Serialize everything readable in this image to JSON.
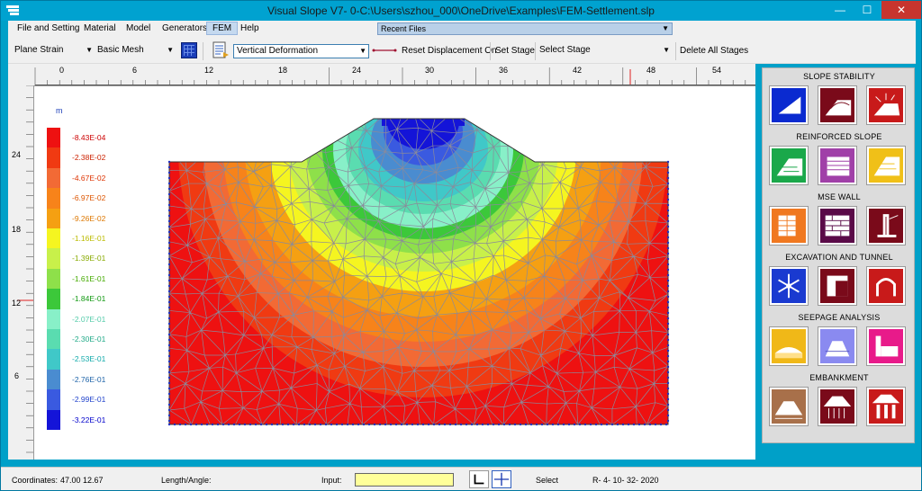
{
  "window": {
    "title": "Visual Slope V7- 0-C:\\Users\\szhou_000\\OneDrive\\Examples\\FEM-Settlement.slp",
    "minimize": "—",
    "maximize": "☐",
    "close": "✕"
  },
  "menu": {
    "items": [
      "File and Setting",
      "Material",
      "Model",
      "Generators",
      "FEM",
      "Help"
    ],
    "active": "FEM",
    "recent_files": "Recent Files"
  },
  "toolbar": {
    "analysis_type": "Plane Strain",
    "mesh_type": "Basic Mesh",
    "result_type": "Vertical Deformation",
    "reset_displacement": "Reset Displacement On",
    "set_stage": "Set Stage",
    "select_stage": "Select Stage",
    "delete_all_stages": "Delete All Stages"
  },
  "ruler": {
    "top_ticks": [
      "0",
      "6",
      "12",
      "18",
      "24",
      "30",
      "36",
      "42",
      "48",
      "54"
    ],
    "left_ticks": [
      "24",
      "18",
      "12",
      "6"
    ]
  },
  "legend": {
    "unit": "m",
    "entries": [
      {
        "label": "-8.43E-04",
        "color": "#ee1111",
        "text_color": "#cc0000"
      },
      {
        "label": "-2.38E-02",
        "color": "#f03a12",
        "text_color": "#cc2200"
      },
      {
        "label": "-4.67E-02",
        "color": "#f26a35",
        "text_color": "#dd3300"
      },
      {
        "label": "-6.97E-02",
        "color": "#f7831a",
        "text_color": "#dd5500"
      },
      {
        "label": "-9.26E-02",
        "color": "#f5a012",
        "text_color": "#dd7700"
      },
      {
        "label": "-1.16E-01",
        "color": "#f5f520",
        "text_color": "#bbbb00"
      },
      {
        "label": "-1.39E-01",
        "color": "#c8f04a",
        "text_color": "#88aa00"
      },
      {
        "label": "-1.61E-01",
        "color": "#8ee04a",
        "text_color": "#44aa00"
      },
      {
        "label": "-1.84E-01",
        "color": "#3cc83a",
        "text_color": "#119911"
      },
      {
        "label": "-2.07E-01",
        "color": "#88f0c8",
        "text_color": "#55ccaa"
      },
      {
        "label": "-2.30E-01",
        "color": "#5adcb0",
        "text_color": "#22aa88"
      },
      {
        "label": "-2.53E-01",
        "color": "#40c8c8",
        "text_color": "#11aaaa"
      },
      {
        "label": "-2.76E-01",
        "color": "#4a8cd0",
        "text_color": "#2266aa"
      },
      {
        "label": "-2.99E-01",
        "color": "#3a5ae0",
        "text_color": "#2244cc"
      },
      {
        "label": "-3.22E-01",
        "color": "#1414d8",
        "text_color": "#0000cc"
      }
    ]
  },
  "right_panel": {
    "sections": [
      {
        "title": "SLOPE STABILITY",
        "buttons": [
          "slope-limit-equilibrium-icon",
          "slope-3d-icon",
          "slope-seismic-icon"
        ],
        "colors": [
          "#0a2ad0",
          "#7a0a1a",
          "#c81a1a"
        ]
      },
      {
        "title": "REINFORCED SLOPE",
        "buttons": [
          "geogrid-slope-icon",
          "soil-nail-slope-icon",
          "reinforced-layers-icon"
        ],
        "colors": [
          "#1aa84a",
          "#a040a8",
          "#f0c018"
        ]
      },
      {
        "title": "MSE WALL",
        "buttons": [
          "mse-block-wall-icon",
          "mse-panel-wall-icon",
          "cantilever-wall-icon"
        ],
        "colors": [
          "#f07820",
          "#5a0a48",
          "#7a0a1a"
        ]
      },
      {
        "title": "EXCAVATION AND TUNNEL",
        "buttons": [
          "frozen-ground-icon",
          "excavation-wall-icon",
          "tunnel-icon"
        ],
        "colors": [
          "#1a3ad0",
          "#7a0a1a",
          "#c81a1a"
        ]
      },
      {
        "title": "SEEPAGE ANALYSIS",
        "buttons": [
          "seepage-dam-icon",
          "seepage-embankment-icon",
          "seepage-wall-icon"
        ],
        "colors": [
          "#f0b818",
          "#8a8af0",
          "#e81a8a"
        ]
      },
      {
        "title": "EMBANKMENT",
        "buttons": [
          "embankment-settlement-icon",
          "embankment-piles-icon",
          "embankment-columns-icon"
        ],
        "colors": [
          "#a8704a",
          "#7a0a1a",
          "#c81a1a"
        ]
      }
    ]
  },
  "status": {
    "coordinates_label": "Coordinates:",
    "coordinates_value": "47.00  12.67",
    "length_label": "Length/Angle:",
    "input_label": "Input:",
    "mode": "Select",
    "version": "R- 4- 10- 32- 2020"
  }
}
